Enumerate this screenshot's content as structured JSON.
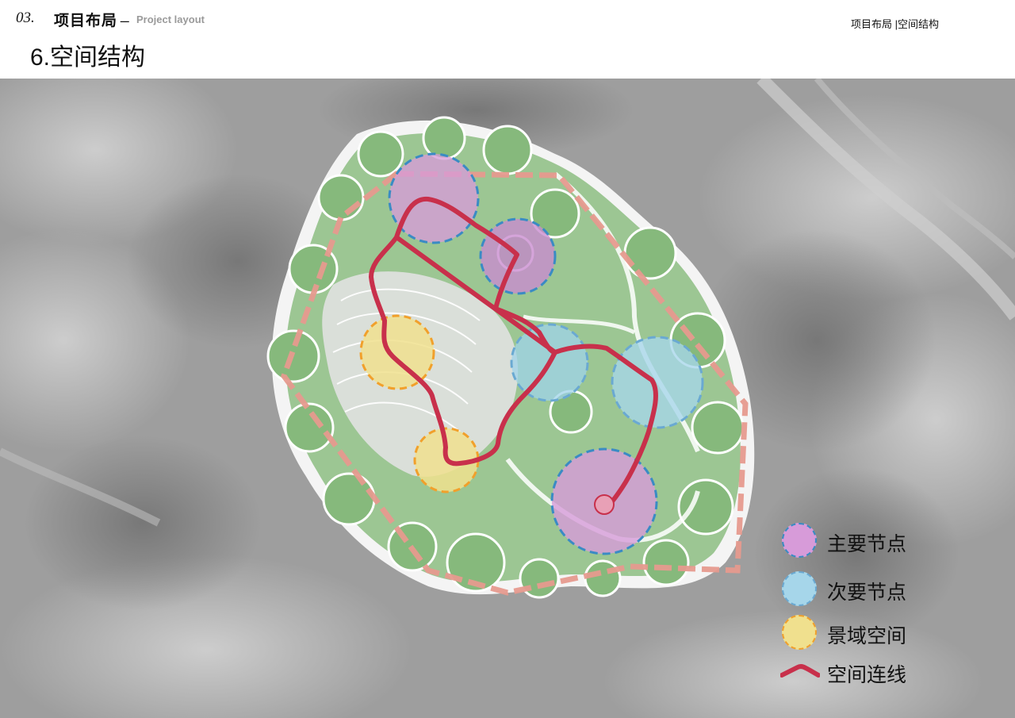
{
  "header": {
    "section_number": "03.",
    "section_title": "项目布局",
    "separator": "_",
    "section_subtitle": "Project layout",
    "breadcrumb": "项目布局 |空间结构",
    "page_title": "6.空间结构"
  },
  "legend": {
    "items": [
      {
        "label": "主要节点",
        "fill": "#d79bd9",
        "stroke": "#3a8bc4"
      },
      {
        "label": "次要节点",
        "fill": "#a6d6ea",
        "stroke": "#6aa9d2"
      },
      {
        "label": "景域空间",
        "fill": "#f0e08e",
        "stroke": "#f1a02b"
      },
      {
        "label": "空间连线",
        "color": "#c8304b"
      }
    ]
  },
  "colors": {
    "primary_node": "#d79bd9",
    "secondary_node": "#9fd3ea",
    "landscape_space": "#f0e08e",
    "connection_line": "#c8304b",
    "boundary": "#e69a8e",
    "vegetation": "#8fbf86"
  }
}
